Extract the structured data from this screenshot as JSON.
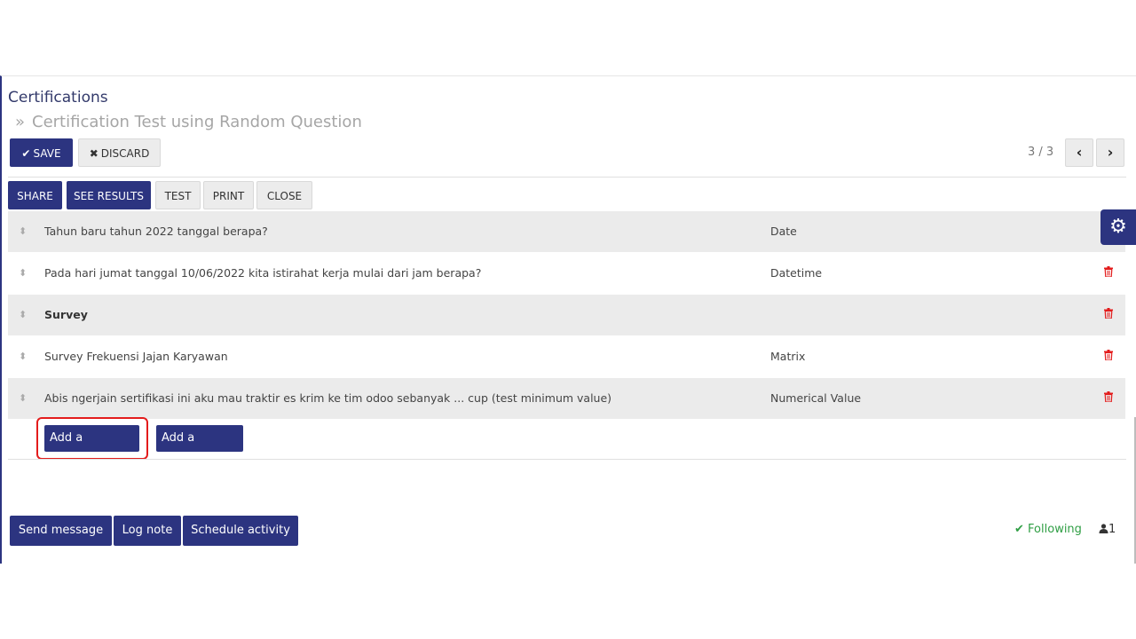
{
  "breadcrumb": {
    "parent": "Certifications",
    "separator": "»",
    "current": "Certification Test using Random Question"
  },
  "form_buttons": {
    "save_icon": "✔",
    "save": "SAVE",
    "discard_icon": "✖",
    "discard": "DISCARD"
  },
  "pager": {
    "value": "3 / 3",
    "prev_icon": "chevron-left-icon",
    "next_icon": "chevron-right-icon",
    "prev_glyph": "‹",
    "next_glyph": "›"
  },
  "header_buttons": {
    "share": "SHARE",
    "see_results": "SEE RESULTS",
    "test": "TEST",
    "print": "PRINT",
    "close": "CLOSE"
  },
  "settings_icon": "⚙",
  "questions": [
    {
      "title": "Tahun baru tahun 2022 tanggal berapa?",
      "type": "Date",
      "is_section": false
    },
    {
      "title": "Pada hari jumat tanggal 10/06/2022 kita istirahat kerja mulai dari jam berapa?",
      "type": "Datetime",
      "is_section": false
    },
    {
      "title": "Survey",
      "type": "",
      "is_section": true
    },
    {
      "title": "Survey Frekuensi Jajan Karyawan",
      "type": "Matrix",
      "is_section": false
    },
    {
      "title": "Abis ngerjain sertifikasi ini aku mau traktir es krim ke tim odoo sebanyak ... cup (test minimum value)",
      "type": "Numerical Value",
      "is_section": false
    }
  ],
  "list_actions": {
    "add_question": "Add a question",
    "add_section": "Add a section"
  },
  "chatter": {
    "send_message": "Send message",
    "log_note": "Log note",
    "schedule_activity": "Schedule activity",
    "following_icon": "✔",
    "following": "Following",
    "followers_icon": "user-icon",
    "followers_count": "1"
  },
  "colors": {
    "primary": "#2c3480",
    "danger": "#e31c1c",
    "success": "#2f9e44"
  }
}
